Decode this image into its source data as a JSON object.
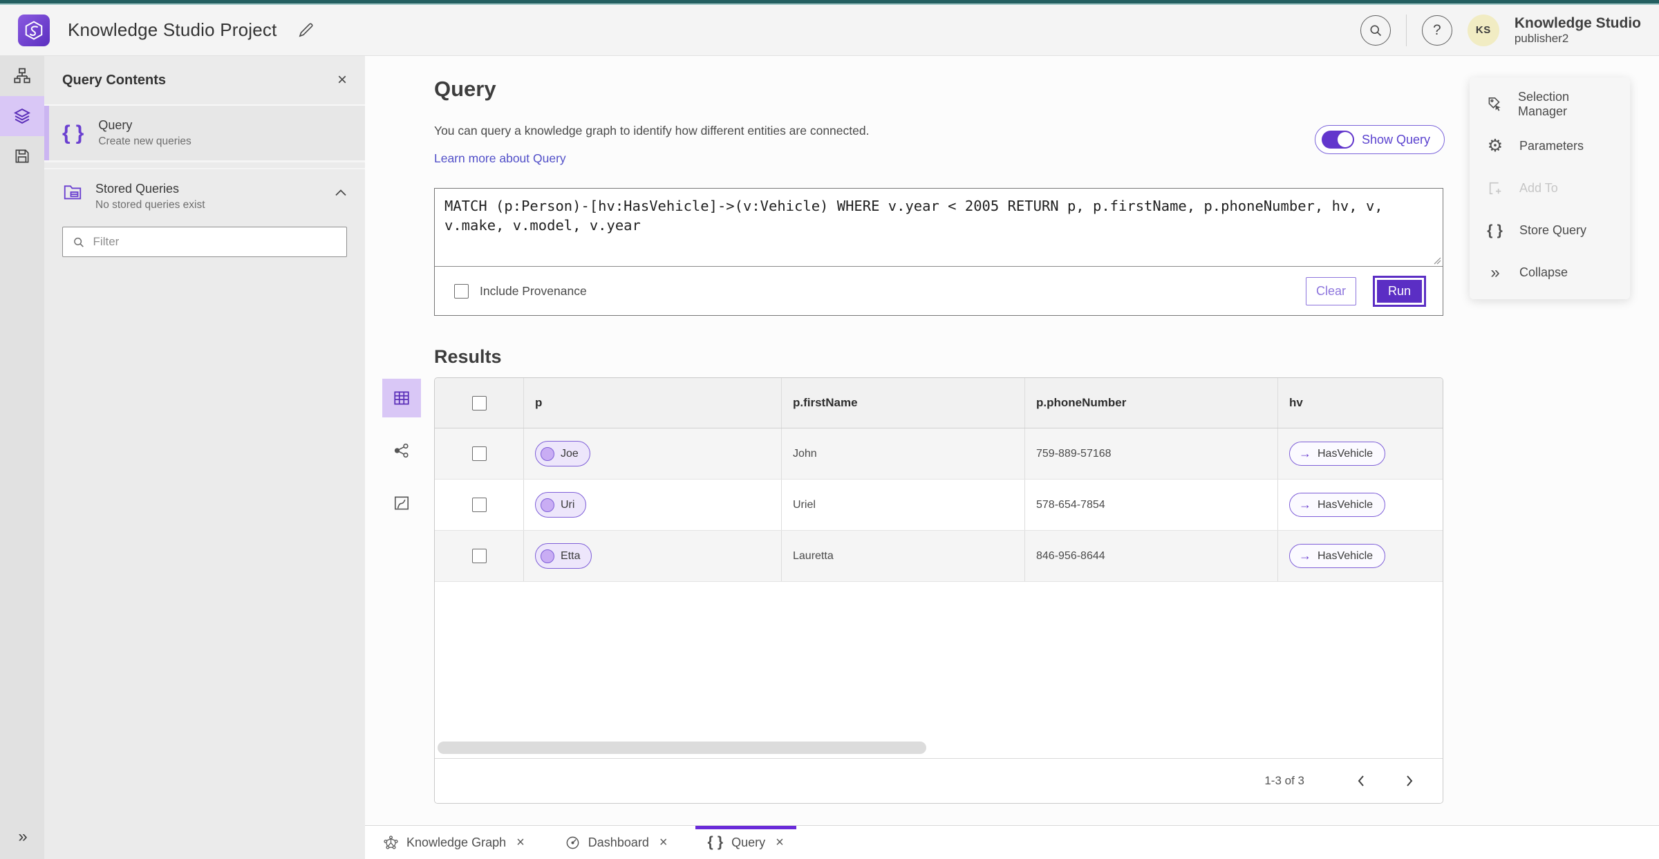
{
  "header": {
    "app_title": "Knowledge Studio Project",
    "user": {
      "initials": "KS",
      "product": "Knowledge Studio",
      "username": "publisher2"
    }
  },
  "left_panel": {
    "title": "Query Contents",
    "query_item": {
      "title": "Query",
      "subtitle": "Create new queries"
    },
    "stored_item": {
      "title": "Stored Queries",
      "subtitle": "No stored queries exist"
    },
    "filter_placeholder": "Filter"
  },
  "query_section": {
    "title": "Query",
    "description": "You can query a knowledge graph to identify how different entities are connected.",
    "learn_more": "Learn more about Query",
    "show_query_label": "Show Query",
    "query_text": "MATCH (p:Person)-[hv:HasVehicle]->(v:Vehicle) WHERE v.year < 2005 RETURN p, p.firstName, p.phoneNumber, hv, v, v.make, v.model, v.year",
    "include_provenance_label": "Include Provenance",
    "clear_label": "Clear",
    "run_label": "Run"
  },
  "results": {
    "title": "Results",
    "columns": [
      "p",
      "p.firstName",
      "p.phoneNumber",
      "hv"
    ],
    "rows": [
      {
        "entity": "Joe",
        "firstName": "John",
        "phoneNumber": "759-889-57168",
        "relationship": "HasVehicle"
      },
      {
        "entity": "Uri",
        "firstName": "Uriel",
        "phoneNumber": "578-654-7854",
        "relationship": "HasVehicle"
      },
      {
        "entity": "Etta",
        "firstName": "Lauretta",
        "phoneNumber": "846-956-8644",
        "relationship": "HasVehicle"
      }
    ],
    "pagination": "1-3 of 3"
  },
  "actions_panel": {
    "items": [
      {
        "label": "Selection Manager",
        "enabled": true
      },
      {
        "label": "Parameters",
        "enabled": true
      },
      {
        "label": "Add To",
        "enabled": false
      },
      {
        "label": "Store Query",
        "enabled": true
      },
      {
        "label": "Collapse",
        "enabled": true
      }
    ]
  },
  "tabs": [
    {
      "label": "Knowledge Graph",
      "active": false
    },
    {
      "label": "Dashboard",
      "active": false
    },
    {
      "label": "Query",
      "active": true
    }
  ],
  "colors": {
    "accent": "#5b2ec4",
    "lavender": "#d9c7f6",
    "teal_top": "#235f60",
    "link": "#514fc8"
  }
}
